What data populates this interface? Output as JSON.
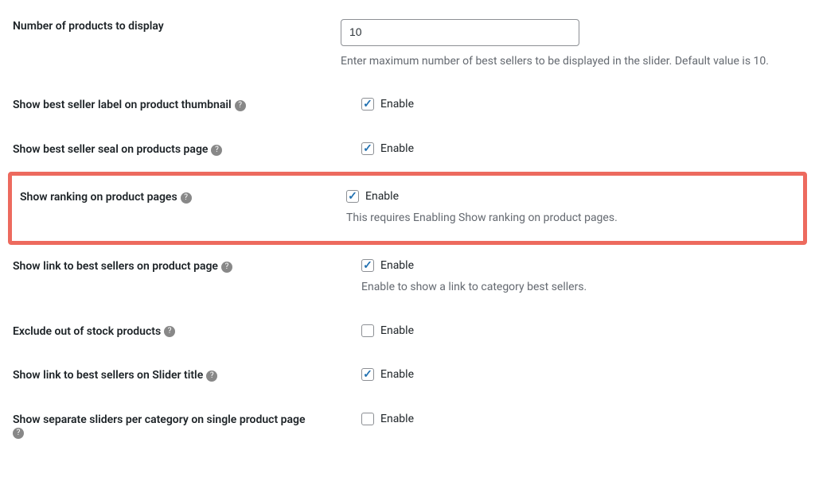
{
  "settings": {
    "numProducts": {
      "label": "Number of products to display",
      "value": "10",
      "help": "Enter maximum number of best sellers to be displayed in the slider. Default value is 10."
    },
    "showLabelThumb": {
      "label": "Show best seller label on product thumbnail",
      "checkbox_label": "Enable",
      "checked": true
    },
    "showSealPage": {
      "label": "Show best seller seal on products page",
      "checkbox_label": "Enable",
      "checked": true
    },
    "showRanking": {
      "label": "Show ranking on product pages",
      "checkbox_label": "Enable",
      "checked": true,
      "help": "This requires Enabling Show ranking on product pages."
    },
    "showLinkProductPage": {
      "label": "Show link to best sellers on product page",
      "checkbox_label": "Enable",
      "checked": true,
      "help": "Enable to show a link to category best sellers."
    },
    "excludeOutOfStock": {
      "label": "Exclude out of stock products",
      "checkbox_label": "Enable",
      "checked": false
    },
    "showLinkSliderTitle": {
      "label": "Show link to best sellers on Slider title",
      "checkbox_label": "Enable",
      "checked": true
    },
    "separateSliders": {
      "label": "Show separate sliders per category on single product page",
      "checkbox_label": "Enable",
      "checked": false
    }
  }
}
